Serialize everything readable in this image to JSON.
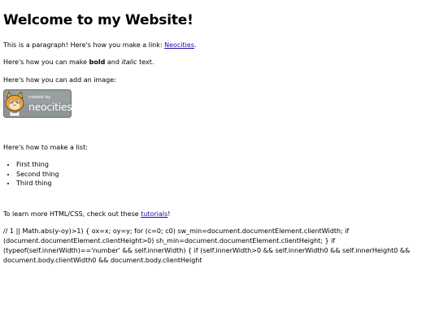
{
  "page": {
    "heading": "Welcome to my Website!",
    "para1_before": "This is a paragraph! Here's how you make a link: ",
    "para1_link": "Neocities",
    "para1_after": ".",
    "para2_before": "Here's how you can make ",
    "para2_bold": "bold",
    "para2_mid": " and ",
    "para2_italic": "italic",
    "para2_after": " text.",
    "para3": "Here's how you can add an image:",
    "badge": {
      "small_text": "hosted by",
      "brand_text": "neocities",
      "colors": {
        "background": "#8f9496",
        "border": "#6c7173",
        "cat": "#e8a53b",
        "text": "#ffffff"
      }
    },
    "para4": "Here's how to make a list:",
    "list_items": [
      "First thing",
      "Second thing",
      "Third thing"
    ],
    "para5_before": "To learn more HTML/CSS, check out these ",
    "para5_link": "tutorials",
    "para5_after": "!",
    "code_text": "// 1 || Math.abs(y-oy)>1) { ox=x; oy=y; for (c=0; c0) sw_min=document.documentElement.clientWidth; if (document.documentElement.clientHeight>0) sh_min=document.documentElement.clientHeight; } if (typeof(self.innerWidth)=='number' && self.innerWidth) { if (self.innerWidth>0 && self.innerWidth0 && self.innerHeight0 && document.body.clientWidth0 && document.body.clientHeight"
  }
}
